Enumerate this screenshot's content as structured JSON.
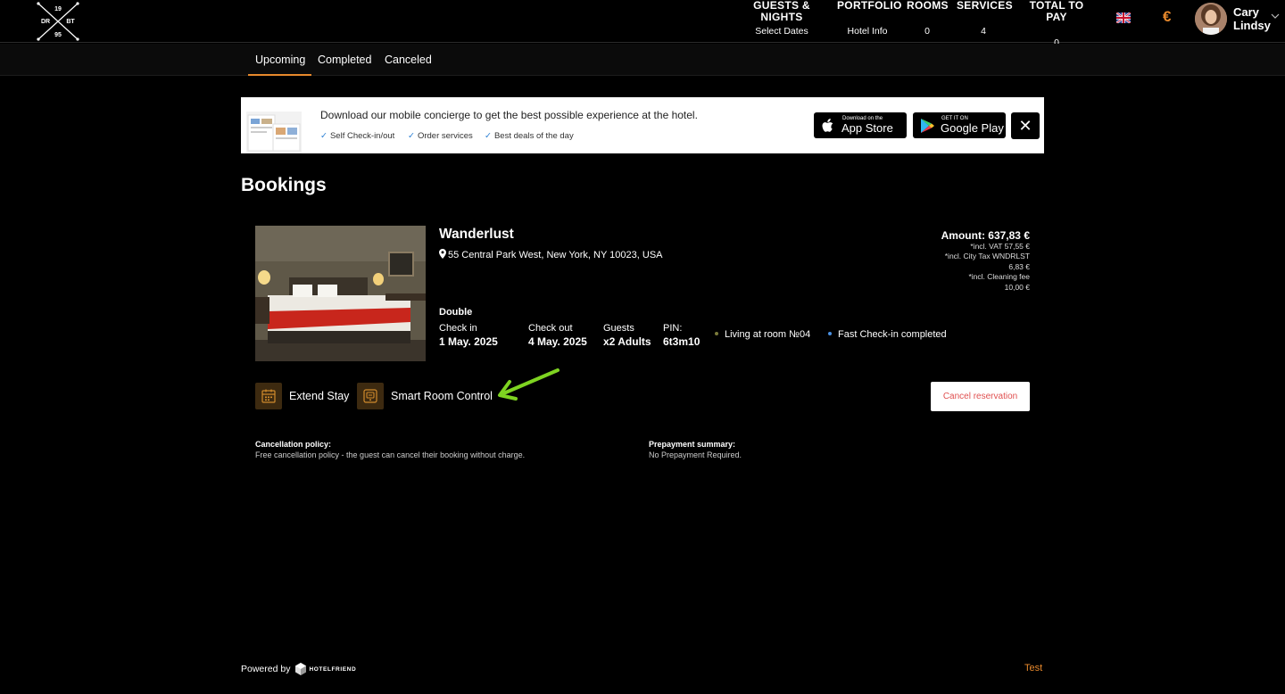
{
  "header": {
    "logo": {
      "top": "19",
      "left": "DR",
      "right": "BT",
      "bottom": "95"
    },
    "columns": [
      {
        "title": "GUESTS & NIGHTS",
        "value": "Select Dates"
      },
      {
        "title": "PORTFOLIO",
        "value": "Hotel Info"
      },
      {
        "title": "ROOMS",
        "value": "0"
      },
      {
        "title": "SERVICES",
        "value": "4"
      },
      {
        "title": "TOTAL TO PAY",
        "value": "0"
      }
    ],
    "currency": "€",
    "user": {
      "first": "Cary",
      "last": "Lindsy"
    }
  },
  "tabs": [
    "Upcoming",
    "Completed",
    "Canceled"
  ],
  "promo": {
    "title": "Download our mobile concierge to get the best possible experience at the hotel.",
    "features": [
      "Self Check-in/out",
      "Order services",
      "Best deals of the day"
    ],
    "appstore": {
      "small": "Download on the",
      "big": "App Store"
    },
    "googleplay": {
      "small": "GET IT ON",
      "big": "Google Play"
    },
    "close": "✕"
  },
  "page_title": "Bookings",
  "booking": {
    "hotel": "Wanderlust",
    "address": "55 Central Park West, New York, NY 10023, USA",
    "room_type": "Double",
    "checkin": {
      "label": "Check in",
      "value": "1 May. 2025"
    },
    "checkout": {
      "label": "Check out",
      "value": "4 May. 2025"
    },
    "guests": {
      "label": "Guests",
      "value": "x2 Adults"
    },
    "pin": {
      "label": "PIN:",
      "value": "6t3m10"
    },
    "status1": "Living at room №04",
    "status2": "Fast Check-in completed",
    "amount": {
      "total": "Amount: 637,83 €",
      "lines": [
        "*incl. VAT  57,55 €",
        "*incl. City Tax WNDRLST",
        "6,83 €",
        "*incl.  Cleaning fee",
        "10,00 €"
      ]
    },
    "actions": {
      "extend": "Extend Stay",
      "smart": "Smart Room Control",
      "cancel": "Cancel reservation"
    },
    "policies": {
      "cancel_title": "Cancellation policy:",
      "cancel_text": "Free cancellation policy - the guest can cancel their booking without charge.",
      "prepay_title": "Prepayment summary:",
      "prepay_text": "No Prepayment Required."
    }
  },
  "footer": {
    "powered": "Powered by",
    "brand": "HOTELFRIEND",
    "test": "Test"
  },
  "colors": {
    "accent": "#e8892c",
    "annotation_arrow": "#7ed321",
    "status_dot_1": "#7a7a3a",
    "status_dot_2": "#4a90e2"
  }
}
